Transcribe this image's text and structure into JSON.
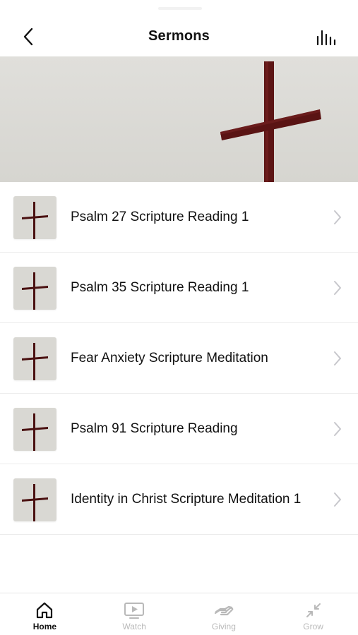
{
  "header": {
    "title": "Sermons",
    "back_icon": "chevron-left-icon",
    "stats_icon": "bar-chart-icon"
  },
  "hero": {
    "image": "cross-banner"
  },
  "sermons": [
    {
      "title": "Psalm 27 Scripture Reading 1"
    },
    {
      "title": "Psalm 35 Scripture Reading 1"
    },
    {
      "title": "Fear Anxiety Scripture Meditation"
    },
    {
      "title": "Psalm 91 Scripture Reading"
    },
    {
      "title": "Identity in Christ Scripture Meditation 1"
    }
  ],
  "tabs": [
    {
      "label": "Home",
      "icon": "home-icon",
      "active": true
    },
    {
      "label": "Watch",
      "icon": "video-icon",
      "active": false
    },
    {
      "label": "Giving",
      "icon": "giving-hand-icon",
      "active": false
    },
    {
      "label": "Grow",
      "icon": "arrows-in-icon",
      "active": false
    }
  ],
  "colors": {
    "active_tab": "#111111",
    "inactive_tab": "#b9b9b9",
    "cross": "#5a1414",
    "hero_background": "#dcdbd6"
  }
}
